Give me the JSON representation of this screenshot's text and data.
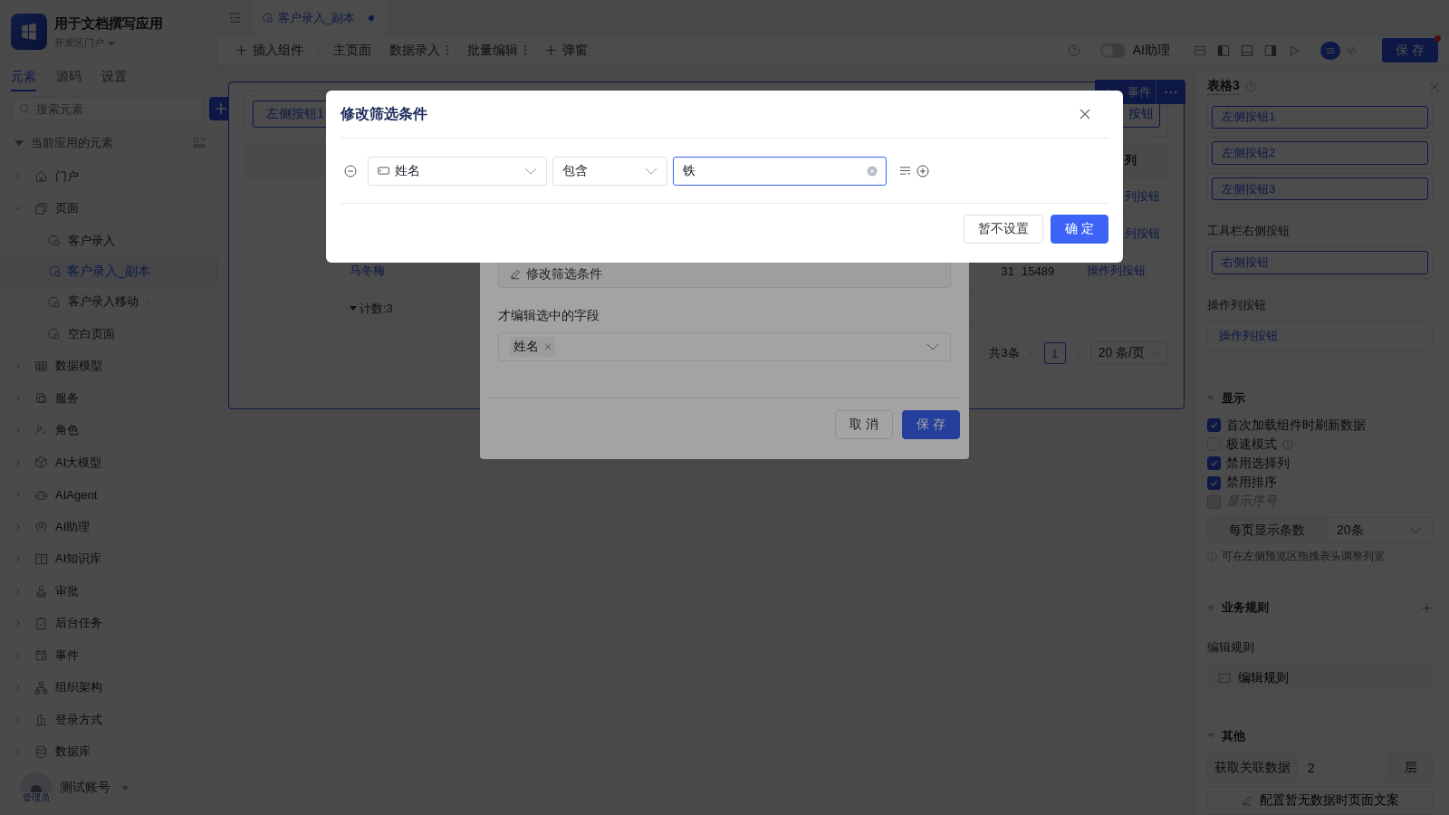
{
  "app": {
    "name": "用于文档撰写应用",
    "portal": "开发区门户"
  },
  "sidebar": {
    "tabs": [
      {
        "label": "元素",
        "selected": true
      },
      {
        "label": "源码",
        "selected": false
      },
      {
        "label": "设置",
        "selected": false
      }
    ],
    "search": {
      "placeholder": "搜索元素"
    },
    "section": {
      "title": "当前应用的元素",
      "expanded": true
    },
    "tree": [
      {
        "kind": "portal",
        "label": "门户",
        "expanded": false,
        "selected": false
      },
      {
        "kind": "pages",
        "label": "页面",
        "expanded": true,
        "selected": false,
        "children": [
          {
            "kind": "page",
            "label": "客户录入",
            "mobile": false,
            "selected": false
          },
          {
            "kind": "page",
            "label": "客户录入_副本",
            "mobile": false,
            "selected": true
          },
          {
            "kind": "page",
            "label": "客户录入移动",
            "mobile": true,
            "selected": false
          },
          {
            "kind": "page",
            "label": "空白页面",
            "mobile": false,
            "selected": false
          }
        ]
      },
      {
        "kind": "data_model",
        "label": "数据模型",
        "expanded": false,
        "selected": false
      },
      {
        "kind": "service",
        "label": "服务",
        "expanded": false,
        "selected": false
      },
      {
        "kind": "role",
        "label": "角色",
        "expanded": false,
        "selected": false
      },
      {
        "kind": "ai_model",
        "label": "AI大模型",
        "expanded": false,
        "selected": false
      },
      {
        "kind": "ai_agent",
        "label": "AIAgent",
        "expanded": false,
        "selected": false
      },
      {
        "kind": "ai_assistant",
        "label": "AI助理",
        "expanded": false,
        "selected": false
      },
      {
        "kind": "ai_knowledge",
        "label": "AI知识库",
        "expanded": false,
        "selected": false
      },
      {
        "kind": "approval",
        "label": "审批",
        "expanded": false,
        "selected": false
      },
      {
        "kind": "task",
        "label": "后台任务",
        "expanded": false,
        "selected": false
      },
      {
        "kind": "event",
        "label": "事件",
        "expanded": false,
        "selected": false
      },
      {
        "kind": "org",
        "label": "组织架构",
        "expanded": false,
        "selected": false
      },
      {
        "kind": "login",
        "label": "登录方式",
        "expanded": false,
        "selected": false
      },
      {
        "kind": "database",
        "label": "数据库",
        "expanded": false,
        "selected": false
      }
    ],
    "user": {
      "name": "测试账号",
      "role": "管理员"
    }
  },
  "editor_tabs": [
    {
      "label": "客户录入_副本",
      "modified": true,
      "selected": true
    }
  ],
  "toolbar": {
    "items": [
      {
        "kind": "insert",
        "label": "插入组件"
      },
      {
        "kind": "plain",
        "label": "主页面"
      },
      {
        "kind": "menu",
        "label": "数据录入"
      },
      {
        "kind": "menu",
        "label": "批量编辑"
      },
      {
        "kind": "insert",
        "label": "弹窗"
      }
    ],
    "ai_toggle": {
      "label": "AI助理",
      "on": false
    },
    "view_modes": [
      {
        "kind": "design",
        "selected": true
      },
      {
        "kind": "code",
        "selected": false
      }
    ],
    "save": {
      "label": "保 存",
      "badge_dot": true
    }
  },
  "canvas": {
    "card_tab": "事件",
    "left_buttons": [
      "左侧按钮1"
    ],
    "right_buttons": [
      "按钮"
    ],
    "table": {
      "action_header": "列",
      "rows": [
        {
          "action": "列按钮"
        },
        {
          "action": "列按钮"
        },
        {
          "name": "马冬梅",
          "age": "31",
          "phone": "15489",
          "action": "操作列按钮"
        }
      ],
      "summary": "计数:3"
    },
    "pagination": {
      "total": "共3条",
      "pages": [
        {
          "label": "1",
          "selected": true
        }
      ],
      "page_size": "20 条/页"
    }
  },
  "right_panel": {
    "title": "表格3",
    "left_buttons": [
      "左侧按钮1",
      "左侧按钮2",
      "左侧按钮3"
    ],
    "right_label": "工具栏右侧按钮",
    "right_buttons": [
      "右侧按钮"
    ],
    "action_label": "操作列按钮",
    "action_buttons": [
      "操作列按钮"
    ],
    "display": {
      "title": "显示",
      "options": [
        {
          "label": "首次加载组件时刷新数据",
          "checked": true,
          "disabled": false,
          "info": false
        },
        {
          "label": "极速模式",
          "checked": false,
          "disabled": false,
          "info": true
        },
        {
          "label": "禁用选择列",
          "checked": true,
          "disabled": false,
          "info": false
        },
        {
          "label": "禁用排序",
          "checked": true,
          "disabled": false,
          "info": false
        },
        {
          "label": "显示序号",
          "checked": false,
          "disabled": true,
          "info": false
        }
      ],
      "page_size": {
        "label": "每页显示条数",
        "value": "20条"
      },
      "note": "可在左侧预览区拖拽表头调整列宽"
    },
    "rules": {
      "title": "业务规则",
      "label": "编辑规则",
      "button": "编辑规则"
    },
    "other": {
      "title": "其他",
      "related": {
        "label": "获取关联数据",
        "value": "2",
        "unit": "层"
      },
      "empty_button": "配置暂无数据时页面文案"
    }
  },
  "filter_dialog": {
    "filter_button": "修改筛选条件",
    "fields_label": "才编辑选中的字段",
    "field_tags": [
      "姓名"
    ],
    "buttons": [
      {
        "kind": "default",
        "label": "取 消"
      },
      {
        "kind": "primary",
        "label": "保 存"
      }
    ]
  },
  "condition_dialog": {
    "title": "修改筛选条件",
    "field": "姓名",
    "operator": "包含",
    "value": "铁",
    "buttons": [
      {
        "kind": "default",
        "label": "暂不设置"
      },
      {
        "kind": "primary",
        "label": "确 定"
      }
    ]
  }
}
